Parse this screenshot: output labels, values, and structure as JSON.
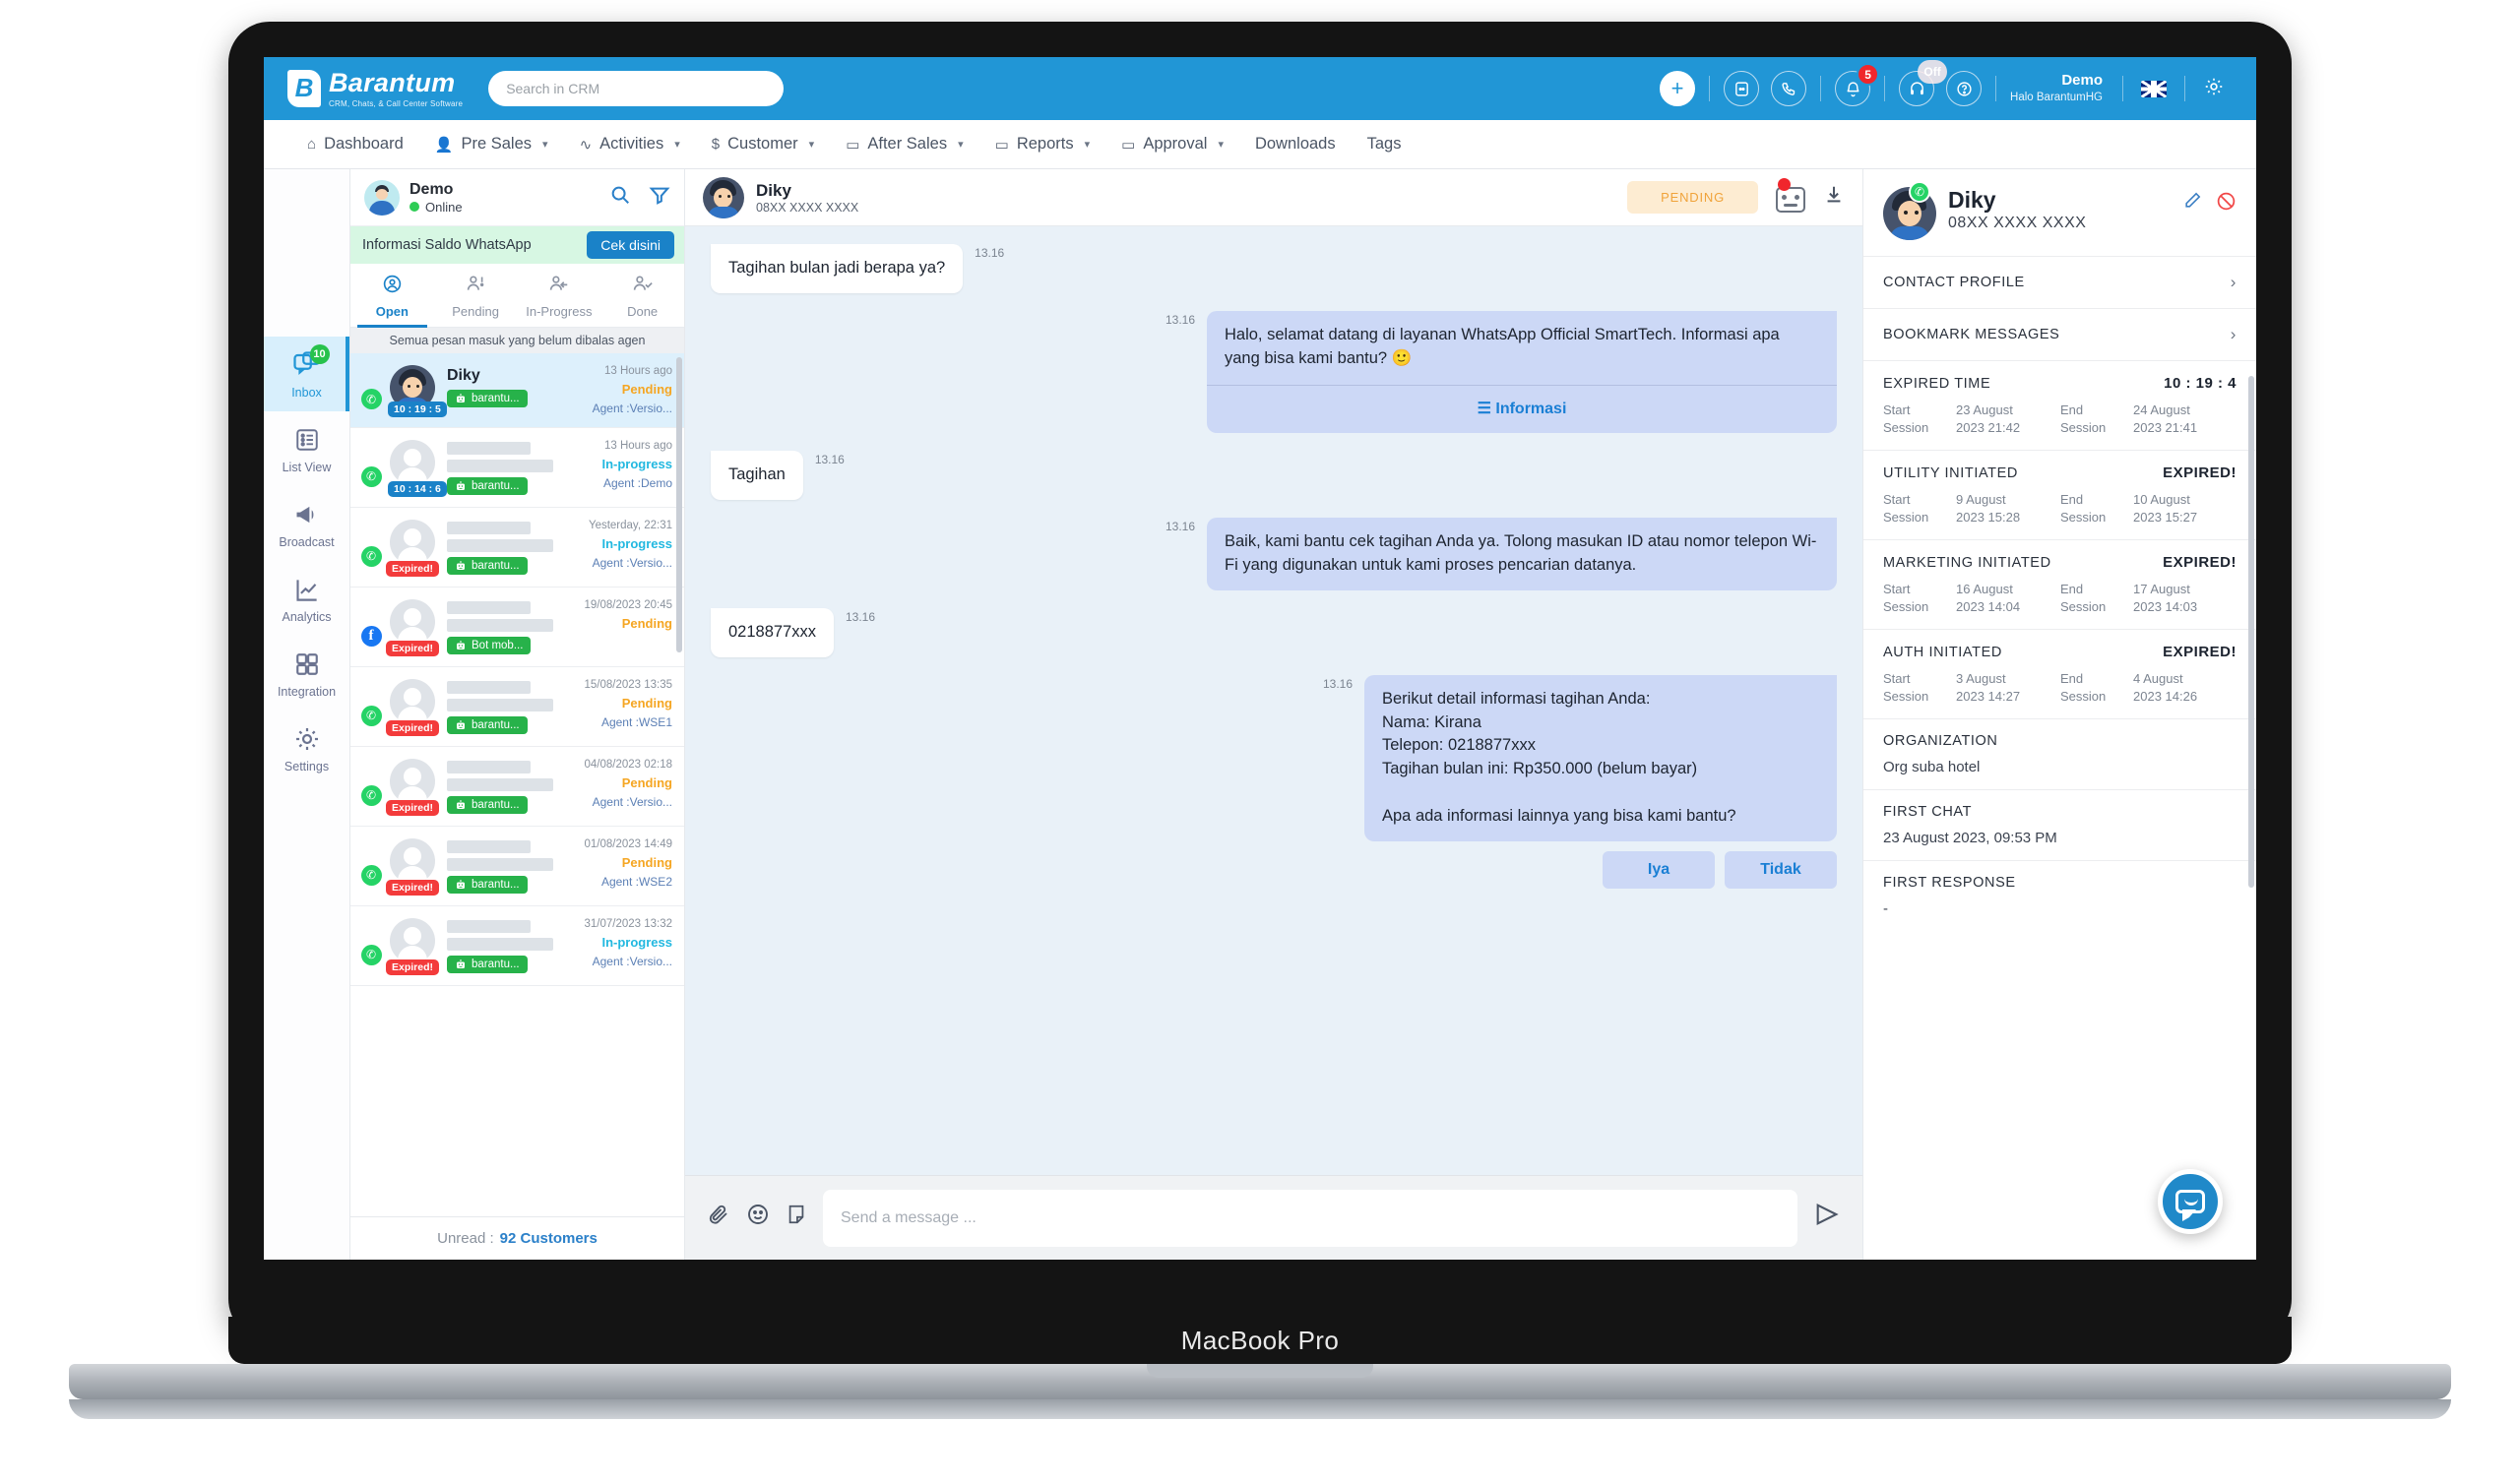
{
  "device": {
    "label": "MacBook Pro"
  },
  "topbar": {
    "brand_name": "Barantum",
    "brand_tagline": "CRM, Chats, & Call Center Software",
    "search_placeholder": "Search in CRM",
    "search_value": "",
    "plus_icon": "plus-icon",
    "chat_icon": "message-icon",
    "call_icon": "phone-icon",
    "bell_icon": "bell-icon",
    "bell_badge": "5",
    "headset_icon": "headset-icon",
    "headset_badge": "Off",
    "help_icon": "help-icon",
    "user_name": "Demo",
    "user_sub": "Halo BarantumHG",
    "flag_icon": "uk-flag-icon",
    "gear_icon": "gear-icon"
  },
  "menu": [
    {
      "label": "Dashboard",
      "icon": "home-icon",
      "caret": false
    },
    {
      "label": "Pre Sales",
      "icon": "people-icon",
      "caret": true
    },
    {
      "label": "Activities",
      "icon": "pulse-icon",
      "caret": true
    },
    {
      "label": "Customer",
      "icon": "dollar-icon",
      "caret": true
    },
    {
      "label": "After Sales",
      "icon": "folder-icon",
      "caret": true
    },
    {
      "label": "Reports",
      "icon": "folder-icon",
      "caret": true
    },
    {
      "label": "Approval",
      "icon": "folder-icon",
      "caret": true
    },
    {
      "label": "Downloads",
      "icon": "",
      "caret": false
    },
    {
      "label": "Tags",
      "icon": "",
      "caret": false
    }
  ],
  "rail": [
    {
      "label": "Inbox",
      "icon": "inbox-chat-icon",
      "badge": "10",
      "active": true
    },
    {
      "label": "List View",
      "icon": "list-icon",
      "badge": "",
      "active": false
    },
    {
      "label": "Broadcast",
      "icon": "megaphone-icon",
      "badge": "",
      "active": false
    },
    {
      "label": "Analytics",
      "icon": "chart-icon",
      "badge": "",
      "active": false
    },
    {
      "label": "Integration",
      "icon": "grid-icon",
      "badge": "",
      "active": false
    },
    {
      "label": "Settings",
      "icon": "gear-icon",
      "badge": "",
      "active": false
    }
  ],
  "chatlist": {
    "agent_name": "Demo",
    "agent_status": "Online",
    "search_icon": "search-icon",
    "filter_icon": "filter-icon",
    "saldo_text": "Informasi Saldo WhatsApp",
    "saldo_button": "Cek disini",
    "tabs": [
      {
        "label": "Open",
        "icon": "user-circle-icon",
        "active": true
      },
      {
        "label": "Pending",
        "icon": "user-alert-icon",
        "active": false
      },
      {
        "label": "In-Progress",
        "icon": "user-arrow-icon",
        "active": false
      },
      {
        "label": "Done",
        "icon": "user-check-icon",
        "active": false
      }
    ],
    "hint": "Semua pesan masuk yang belum dibalas agen",
    "items": [
      {
        "channel": "whatsapp",
        "name": "Diky",
        "masked": false,
        "timer": "10 : 19 : 5",
        "expired": false,
        "bot": "barantu...",
        "time": "13 Hours ago",
        "status": "Pending",
        "status_type": "pending",
        "agent": "Agent :Versio...",
        "selected": true
      },
      {
        "channel": "whatsapp",
        "name": "",
        "masked": true,
        "timer": "10 : 14 : 6",
        "expired": false,
        "bot": "barantu...",
        "time": "13 Hours ago",
        "status": "In-progress",
        "status_type": "inprogress",
        "agent": "Agent :Demo",
        "selected": false
      },
      {
        "channel": "whatsapp",
        "name": "",
        "masked": true,
        "timer": "Expired!",
        "expired": true,
        "bot": "barantu...",
        "time": "Yesterday, 22:31",
        "status": "In-progress",
        "status_type": "inprogress",
        "agent": "Agent :Versio...",
        "selected": false
      },
      {
        "channel": "facebook",
        "name": "",
        "masked": true,
        "timer": "Expired!",
        "expired": true,
        "bot": "Bot mob...",
        "time": "19/08/2023 20:45",
        "status": "Pending",
        "status_type": "pending",
        "agent": "",
        "selected": false
      },
      {
        "channel": "whatsapp",
        "name": "",
        "masked": true,
        "timer": "Expired!",
        "expired": true,
        "bot": "barantu...",
        "time": "15/08/2023 13:35",
        "status": "Pending",
        "status_type": "pending",
        "agent": "Agent :WSE1",
        "selected": false
      },
      {
        "channel": "whatsapp",
        "name": "",
        "masked": true,
        "timer": "Expired!",
        "expired": true,
        "bot": "barantu...",
        "time": "04/08/2023 02:18",
        "status": "Pending",
        "status_type": "pending",
        "agent": "Agent :Versio...",
        "selected": false
      },
      {
        "channel": "whatsapp",
        "name": "",
        "masked": true,
        "timer": "Expired!",
        "expired": true,
        "bot": "barantu...",
        "time": "01/08/2023 14:49",
        "status": "Pending",
        "status_type": "pending",
        "agent": "Agent :WSE2",
        "selected": false
      },
      {
        "channel": "whatsapp",
        "name": "",
        "masked": true,
        "timer": "Expired!",
        "expired": true,
        "bot": "barantu...",
        "time": "31/07/2023 13:32",
        "status": "In-progress",
        "status_type": "inprogress",
        "agent": "Agent :Versio...",
        "selected": false
      }
    ],
    "unread_label": "Unread :",
    "unread_value": "92 Customers"
  },
  "conversation": {
    "name": "Diky",
    "phone": "08XX XXXX XXXX",
    "status_pill": "PENDING",
    "bot_icon": "bot-icon",
    "download_icon": "download-icon",
    "messages": [
      {
        "dir": "in",
        "time": "13.16",
        "text": "Tagihan bulan jadi berapa ya?",
        "footer": "",
        "buttons": []
      },
      {
        "dir": "out",
        "time": "13.16",
        "text": "Halo, selamat datang di layanan WhatsApp Official SmartTech. Informasi apa yang bisa kami bantu? 🙂",
        "footer": "☰  Informasi",
        "buttons": []
      },
      {
        "dir": "in",
        "time": "13.16",
        "text": "Tagihan",
        "footer": "",
        "buttons": []
      },
      {
        "dir": "out",
        "time": "13.16",
        "text": "Baik, kami bantu cek tagihan Anda ya. Tolong masukan ID atau nomor telepon Wi-Fi yang digunakan untuk kami proses pencarian datanya.",
        "footer": "",
        "buttons": []
      },
      {
        "dir": "in",
        "time": "13.16",
        "text": "0218877xxx",
        "footer": "",
        "buttons": []
      },
      {
        "dir": "out",
        "time": "13.16",
        "text": "Berikut detail informasi tagihan Anda:\nNama: Kirana\nTelepon: 0218877xxx\nTagihan bulan ini: Rp350.000 (belum bayar)\n\nApa ada informasi lainnya yang bisa kami bantu?",
        "footer": "",
        "buttons": [
          "Iya",
          "Tidak"
        ]
      }
    ],
    "composer": {
      "attach_icon": "paperclip-icon",
      "emoji_icon": "emoji-icon",
      "note_icon": "note-icon",
      "placeholder": "Send a message ...",
      "value": "",
      "send_icon": "send-icon"
    }
  },
  "rightpanel": {
    "name": "Diky",
    "phone": "08XX XXXX XXXX",
    "edit_icon": "pencil-icon",
    "block_icon": "block-icon",
    "links": [
      {
        "label": "CONTACT PROFILE"
      },
      {
        "label": "BOOKMARK MESSAGES"
      }
    ],
    "sessions": [
      {
        "title": "EXPIRED TIME",
        "value": "10 : 19 : 4",
        "start_label": "Start Session",
        "start_value": "23 August 2023 21:42",
        "end_label": "End Session",
        "end_value": "24 August 2023 21:41"
      },
      {
        "title": "UTILITY INITIATED",
        "value": "EXPIRED!",
        "start_label": "Start Session",
        "start_value": "9 August 2023 15:28",
        "end_label": "End Session",
        "end_value": "10 August 2023 15:27"
      },
      {
        "title": "MARKETING INITIATED",
        "value": "EXPIRED!",
        "start_label": "Start Session",
        "start_value": "16 August 2023 14:04",
        "end_label": "End Session",
        "end_value": "17 August 2023 14:03"
      },
      {
        "title": "AUTH INITIATED",
        "value": "EXPIRED!",
        "start_label": "Start Session",
        "start_value": "3 August 2023 14:27",
        "end_label": "End Session",
        "end_value": "4 August 2023 14:26"
      }
    ],
    "fields": [
      {
        "label": "ORGANIZATION",
        "value": "Org suba hotel"
      },
      {
        "label": "FIRST CHAT",
        "value": "23 August 2023, 09:53 PM"
      },
      {
        "label": "FIRST RESPONSE",
        "value": "-"
      }
    ]
  },
  "widget": {
    "icon": "chat-widget-icon"
  }
}
